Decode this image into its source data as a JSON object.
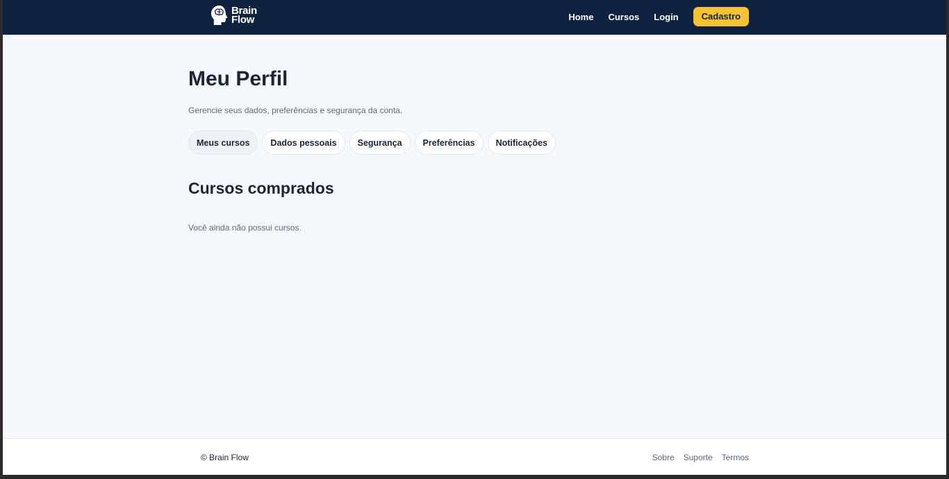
{
  "header": {
    "logo_line1": "Brain",
    "logo_line2": "Flow",
    "nav": [
      "Home",
      "Cursos",
      "Login"
    ],
    "cta_label": "Cadastro"
  },
  "main": {
    "title": "Meu Perfil",
    "subtitle": "Gerencie seus dados, preferências e segurança da conta.",
    "tabs": [
      {
        "label": "Meus cursos",
        "active": true
      },
      {
        "label": "Dados pessoais",
        "active": false
      },
      {
        "label": "Segurança",
        "active": false
      },
      {
        "label": "Preferências",
        "active": false
      },
      {
        "label": "Notificações",
        "active": false
      }
    ],
    "section_title": "Cursos comprados",
    "empty_message": "Você ainda não possui cursos."
  },
  "footer": {
    "copyright": "© Brain Flow",
    "links": [
      "Sobre",
      "Suporte",
      "Termos"
    ]
  },
  "colors": {
    "navbar": "#0f2340",
    "accent": "#f5c233",
    "background": "#f5f8fc",
    "text": "#1b2536",
    "muted": "#5c6878"
  },
  "icons": {
    "logo": "brain-head-icon"
  }
}
